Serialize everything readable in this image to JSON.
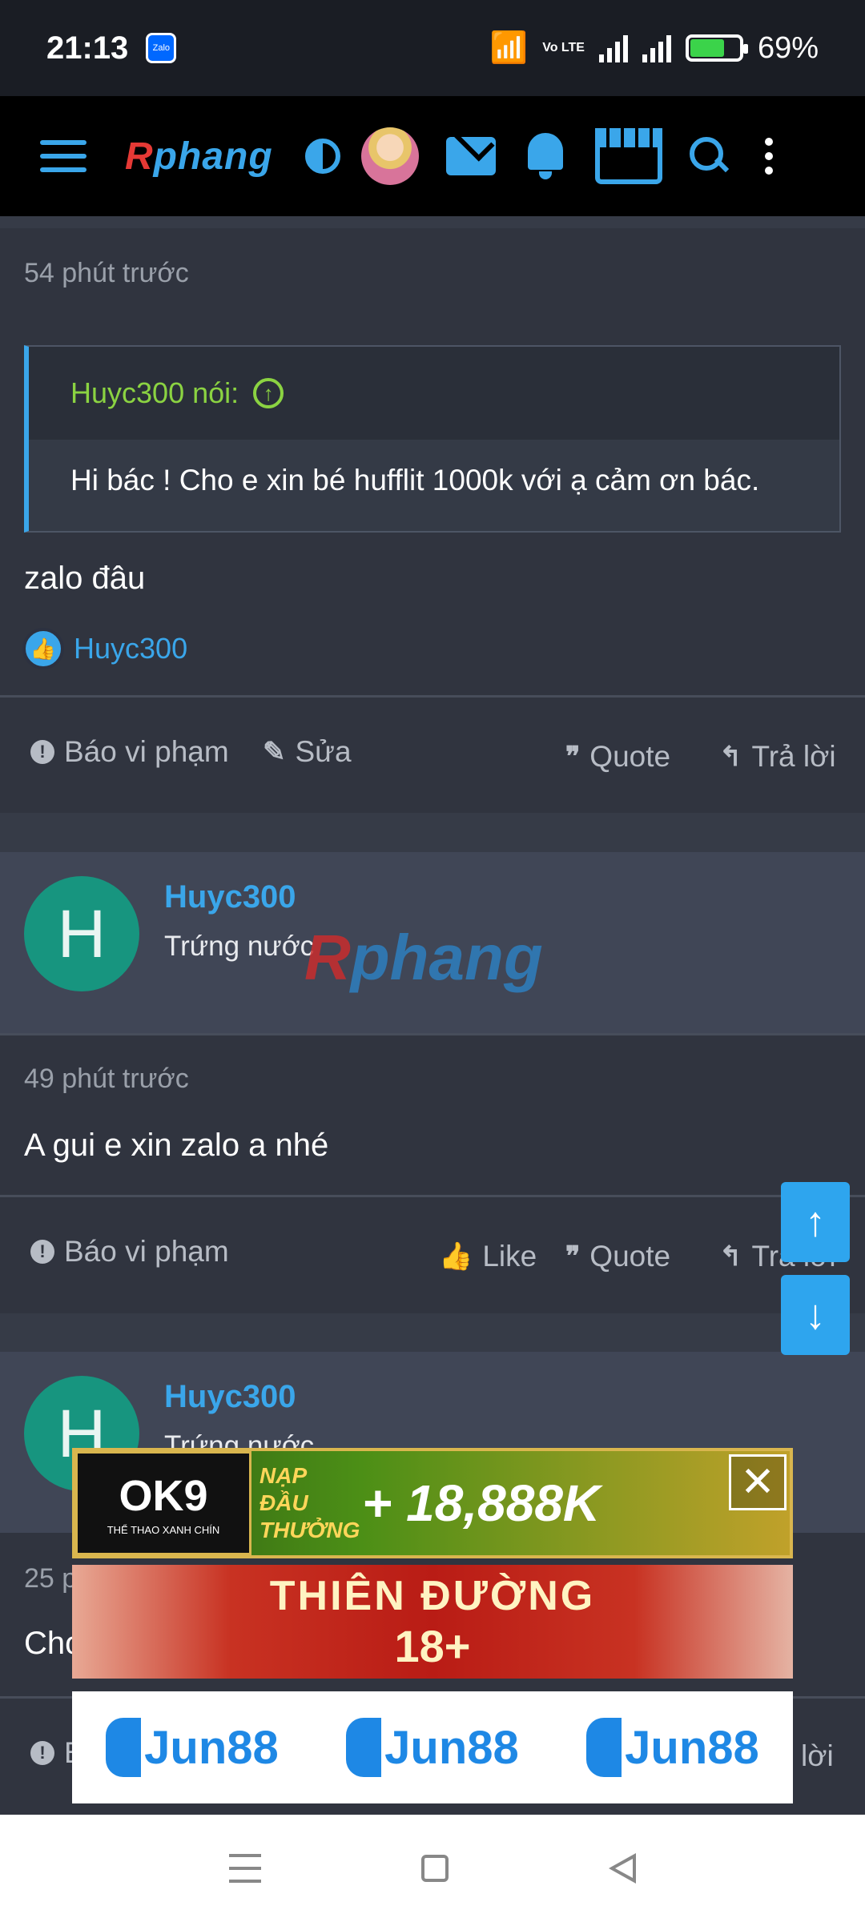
{
  "status_bar": {
    "time": "21:13",
    "notification_app": "Zalo",
    "network": "Vo LTE",
    "battery": "69%"
  },
  "nav": {
    "logo": "Rphang",
    "icons": [
      "menu-icon",
      "contrast-icon",
      "user-avatar",
      "mail-icon",
      "bell-icon",
      "store-icon",
      "search-icon",
      "more-icon"
    ]
  },
  "post1": {
    "time": "54 phút trước",
    "quote_author": "Huyc300 nói:",
    "quote_text": "Hi bác ! Cho e xin bé hufflit 1000k với ạ cảm ơn bác.",
    "message": "zalo đâu",
    "reaction_user": "Huyc300",
    "actions": {
      "report": "Báo vi phạm",
      "edit": "Sửa",
      "quote": "Quote",
      "reply": "Trả lời"
    }
  },
  "post2": {
    "user_initial": "H",
    "username": "Huyc300",
    "user_title": "Trứng nước",
    "time": "49 phút trước",
    "message": "A gui e xin zalo a nhé",
    "actions": {
      "report": "Báo vi phạm",
      "like": "Like",
      "quote": "Quote",
      "reply": "Trả lời"
    }
  },
  "post3": {
    "user_initial": "H",
    "username": "Huyc300",
    "user_title": "Trứng nước",
    "time_partial": "25 p",
    "message_partial": "Cho",
    "report_partial": "B",
    "reply_partial": "lời"
  },
  "watermark": {
    "prefix": "R",
    "rest": "phang"
  },
  "ads": {
    "ok9": {
      "logo": "OK9",
      "logo_sub": "THỂ THAO XANH CHÍN",
      "label": "NẠP ĐẦU THƯỞNG",
      "amount": "+ 18,888K"
    },
    "heaven": {
      "line1": "THIÊN ĐƯỜNG",
      "line2": "18+"
    },
    "jun88": [
      "Jun88",
      "Jun88",
      "Jun88"
    ]
  },
  "scroll": {
    "up": "↑",
    "down": "↓"
  }
}
